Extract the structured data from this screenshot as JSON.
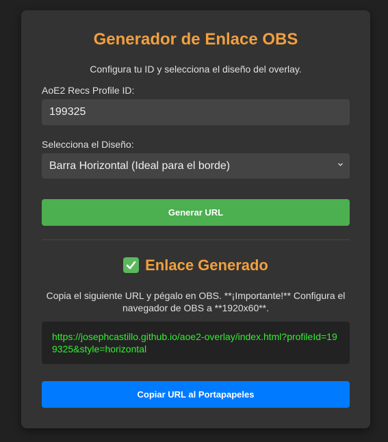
{
  "header": {
    "title": "Generador de Enlace OBS",
    "subtitle": "Configura tu ID y selecciona el diseño del overlay."
  },
  "form": {
    "profile_label": "AoE2 Recs Profile ID:",
    "profile_value": "199325",
    "design_label": "Selecciona el Diseño:",
    "design_value": "Barra Horizontal (Ideal para el borde)",
    "generate_label": "Generar URL"
  },
  "result": {
    "title": "Enlace Generado",
    "instructions": "Copia el siguiente URL y pégalo en OBS. **¡Importante!** Configura el navegador de OBS a **1920x60**.",
    "url": "https://josephcastillo.github.io/aoe2-overlay/index.html?profileId=199325&style=horizontal",
    "copy_label": "Copiar URL al Portapapeles"
  },
  "colors": {
    "accent": "#f0a040",
    "success": "#4caf50",
    "primary": "#007bff",
    "url_text": "#33ee33"
  },
  "icons": {
    "check": "check-mark-icon",
    "chevron": "chevron-down-icon"
  }
}
